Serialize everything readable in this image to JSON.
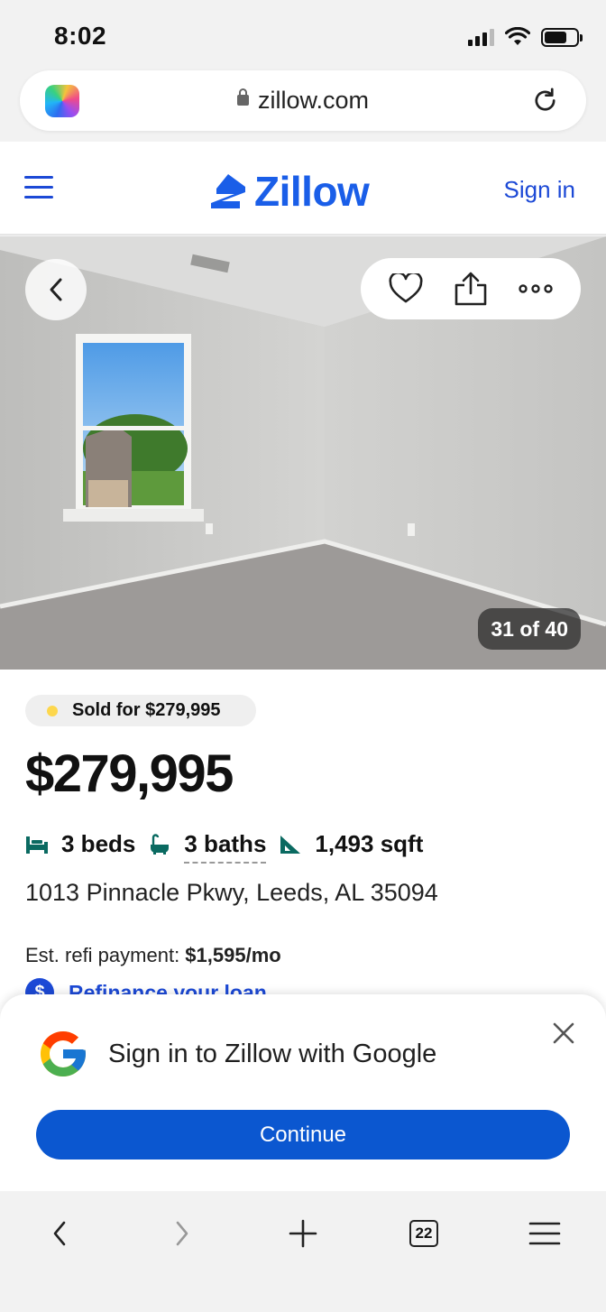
{
  "status_bar": {
    "time": "8:02"
  },
  "browser": {
    "url": "zillow.com",
    "tabs_count": "22"
  },
  "header": {
    "logo_text": "Zillow",
    "sign_in": "Sign in"
  },
  "photo": {
    "counter": "31 of 40"
  },
  "listing": {
    "sold_badge": "Sold for $279,995",
    "price": "$279,995",
    "beds": "3 beds",
    "baths": "3 baths",
    "sqft": "1,493 sqft",
    "address": "1013 Pinnacle Pkwy, Leeds, AL 35094",
    "est_label": "Est. refi payment: ",
    "est_value": "$1,595/mo",
    "refinance_link": "Refinance your loan"
  },
  "google_prompt": {
    "title": "Sign in to Zillow with Google",
    "continue": "Continue"
  },
  "colors": {
    "zillow_blue": "#1a5ee8",
    "google_blue": "#0b57d0",
    "sold_dot": "#fdd74d"
  }
}
